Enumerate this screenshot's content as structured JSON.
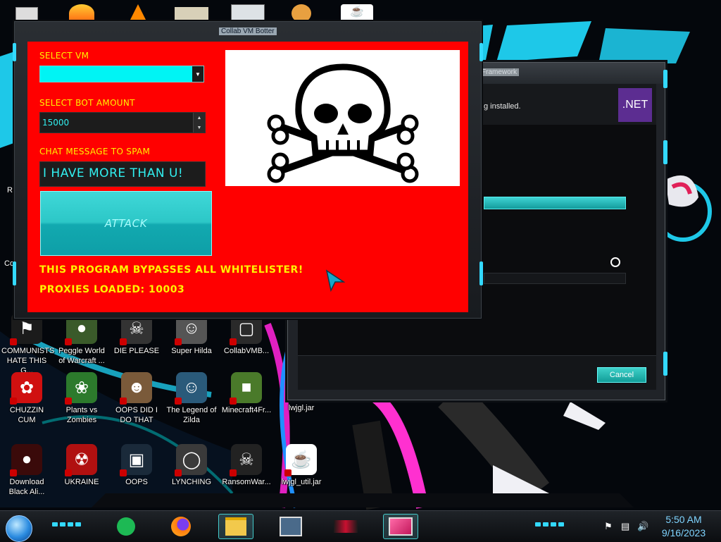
{
  "desktop": {
    "icons": [
      {
        "label": "COMMUNISTS HATE THIS G...",
        "icon": "shield-red-icon",
        "color": "#1b1b1b"
      },
      {
        "label": "Peggle World of Warcraft ...",
        "icon": "game-icon",
        "color": "#3a5a2a"
      },
      {
        "label": "DIE PLEASE",
        "icon": "bomb-icon",
        "color": "#333"
      },
      {
        "label": "Super Hilda",
        "icon": "pixel-character-icon",
        "color": "#555"
      },
      {
        "label": "CollabVMB...",
        "icon": "app-icon",
        "color": "#2a2a2a"
      },
      {
        "label": "CHUZZIN CUM",
        "icon": "chuzzle-icon",
        "color": "#d01010"
      },
      {
        "label": "Plants vs Zombies",
        "icon": "flower-icon",
        "color": "#2c7a2c"
      },
      {
        "label": "OOPS DID I DO THAT",
        "icon": "portrait-icon",
        "color": "#7a5a3a"
      },
      {
        "label": "The Legend of Zilda",
        "icon": "pixel-hero-icon",
        "color": "#2a5a7a"
      },
      {
        "label": "Minecraft4Fr...",
        "icon": "grass-block-icon",
        "color": "#4a7a2a"
      },
      {
        "label": "lwjgl.jar",
        "icon": "",
        "color": ""
      },
      {
        "label": "Download Black Ali...",
        "icon": "red-orb-icon",
        "color": "#3a0a0a"
      },
      {
        "label": "UKRAINE",
        "icon": "radiation-icon",
        "color": "#b01010"
      },
      {
        "label": "OOPS",
        "icon": "monitor-icon",
        "color": "#1a2a3a"
      },
      {
        "label": "LYNCHING",
        "icon": "noose-icon",
        "color": "#3a3a3a"
      },
      {
        "label": "RansomWar...",
        "icon": "skull-icon",
        "color": "#222"
      },
      {
        "label": "lwjgl_util.jar",
        "icon": "java-icon",
        "color": "#fff"
      }
    ],
    "partial_left_labels": [
      "Re",
      "Co"
    ],
    "top_icons": [
      "firefox-icon",
      "vlc-icon",
      "video-icon",
      "app-window-icon",
      "potato-icon",
      "java-icon"
    ]
  },
  "net_window": {
    "title": "Framework",
    "message": "g installed.",
    "logo": ".NET",
    "progress_text": "",
    "cancel_label": "Cancel"
  },
  "bot_window": {
    "title": "Collab VM Botter",
    "select_vm_label": "SELECT VM",
    "select_vm_value": "",
    "bot_amount_label": "SELECT BOT AMOUNT",
    "bot_amount_value": "15000",
    "chat_label": "CHAT MESSAGE TO SPAM",
    "chat_value": "I HAVE MORE THAN U!",
    "attack_label": "ATTACK",
    "bypass_text": "THIS PROGRAM BYPASSES ALL WHITELISTER!",
    "proxies_text": "PROXIES LOADED: 10003",
    "image_icon": "skull-and-crossbones-icon"
  },
  "taskbar": {
    "apps": [
      "spotify-icon",
      "firefox-icon",
      "file-explorer-icon",
      "network-computers-icon",
      "media-player-icon",
      "monitor-app-icon"
    ],
    "time": "5:50 AM",
    "date": "9/16/2023",
    "tray": [
      "flag-icon",
      "network-icon",
      "volume-icon"
    ]
  },
  "colors": {
    "form_background": "#ff0000",
    "label_yellow": "#fff200",
    "accent_cyan": "#33d9ff",
    "input_text": "#31f0f0",
    "dotnet_purple": "#5c2d91"
  }
}
